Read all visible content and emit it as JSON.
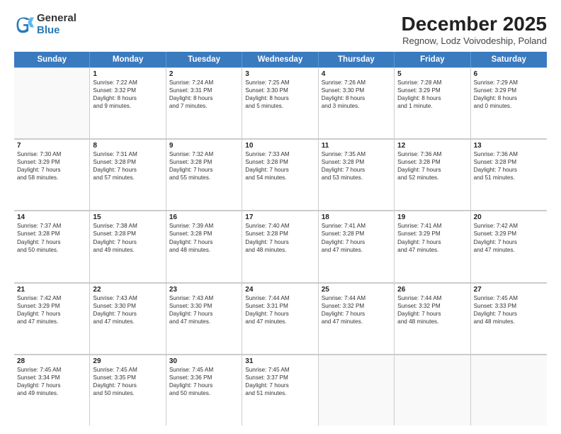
{
  "logo": {
    "general": "General",
    "blue": "Blue"
  },
  "header": {
    "title": "December 2025",
    "subtitle": "Regnow, Lodz Voivodeship, Poland"
  },
  "weekdays": [
    "Sunday",
    "Monday",
    "Tuesday",
    "Wednesday",
    "Thursday",
    "Friday",
    "Saturday"
  ],
  "weeks": [
    [
      {
        "day": "",
        "info": ""
      },
      {
        "day": "1",
        "info": "Sunrise: 7:22 AM\nSunset: 3:32 PM\nDaylight: 8 hours\nand 9 minutes."
      },
      {
        "day": "2",
        "info": "Sunrise: 7:24 AM\nSunset: 3:31 PM\nDaylight: 8 hours\nand 7 minutes."
      },
      {
        "day": "3",
        "info": "Sunrise: 7:25 AM\nSunset: 3:30 PM\nDaylight: 8 hours\nand 5 minutes."
      },
      {
        "day": "4",
        "info": "Sunrise: 7:26 AM\nSunset: 3:30 PM\nDaylight: 8 hours\nand 3 minutes."
      },
      {
        "day": "5",
        "info": "Sunrise: 7:28 AM\nSunset: 3:29 PM\nDaylight: 8 hours\nand 1 minute."
      },
      {
        "day": "6",
        "info": "Sunrise: 7:29 AM\nSunset: 3:29 PM\nDaylight: 8 hours\nand 0 minutes."
      }
    ],
    [
      {
        "day": "7",
        "info": "Sunrise: 7:30 AM\nSunset: 3:29 PM\nDaylight: 7 hours\nand 58 minutes."
      },
      {
        "day": "8",
        "info": "Sunrise: 7:31 AM\nSunset: 3:28 PM\nDaylight: 7 hours\nand 57 minutes."
      },
      {
        "day": "9",
        "info": "Sunrise: 7:32 AM\nSunset: 3:28 PM\nDaylight: 7 hours\nand 55 minutes."
      },
      {
        "day": "10",
        "info": "Sunrise: 7:33 AM\nSunset: 3:28 PM\nDaylight: 7 hours\nand 54 minutes."
      },
      {
        "day": "11",
        "info": "Sunrise: 7:35 AM\nSunset: 3:28 PM\nDaylight: 7 hours\nand 53 minutes."
      },
      {
        "day": "12",
        "info": "Sunrise: 7:36 AM\nSunset: 3:28 PM\nDaylight: 7 hours\nand 52 minutes."
      },
      {
        "day": "13",
        "info": "Sunrise: 7:36 AM\nSunset: 3:28 PM\nDaylight: 7 hours\nand 51 minutes."
      }
    ],
    [
      {
        "day": "14",
        "info": "Sunrise: 7:37 AM\nSunset: 3:28 PM\nDaylight: 7 hours\nand 50 minutes."
      },
      {
        "day": "15",
        "info": "Sunrise: 7:38 AM\nSunset: 3:28 PM\nDaylight: 7 hours\nand 49 minutes."
      },
      {
        "day": "16",
        "info": "Sunrise: 7:39 AM\nSunset: 3:28 PM\nDaylight: 7 hours\nand 48 minutes."
      },
      {
        "day": "17",
        "info": "Sunrise: 7:40 AM\nSunset: 3:28 PM\nDaylight: 7 hours\nand 48 minutes."
      },
      {
        "day": "18",
        "info": "Sunrise: 7:41 AM\nSunset: 3:28 PM\nDaylight: 7 hours\nand 47 minutes."
      },
      {
        "day": "19",
        "info": "Sunrise: 7:41 AM\nSunset: 3:29 PM\nDaylight: 7 hours\nand 47 minutes."
      },
      {
        "day": "20",
        "info": "Sunrise: 7:42 AM\nSunset: 3:29 PM\nDaylight: 7 hours\nand 47 minutes."
      }
    ],
    [
      {
        "day": "21",
        "info": "Sunrise: 7:42 AM\nSunset: 3:29 PM\nDaylight: 7 hours\nand 47 minutes."
      },
      {
        "day": "22",
        "info": "Sunrise: 7:43 AM\nSunset: 3:30 PM\nDaylight: 7 hours\nand 47 minutes."
      },
      {
        "day": "23",
        "info": "Sunrise: 7:43 AM\nSunset: 3:30 PM\nDaylight: 7 hours\nand 47 minutes."
      },
      {
        "day": "24",
        "info": "Sunrise: 7:44 AM\nSunset: 3:31 PM\nDaylight: 7 hours\nand 47 minutes."
      },
      {
        "day": "25",
        "info": "Sunrise: 7:44 AM\nSunset: 3:32 PM\nDaylight: 7 hours\nand 47 minutes."
      },
      {
        "day": "26",
        "info": "Sunrise: 7:44 AM\nSunset: 3:32 PM\nDaylight: 7 hours\nand 48 minutes."
      },
      {
        "day": "27",
        "info": "Sunrise: 7:45 AM\nSunset: 3:33 PM\nDaylight: 7 hours\nand 48 minutes."
      }
    ],
    [
      {
        "day": "28",
        "info": "Sunrise: 7:45 AM\nSunset: 3:34 PM\nDaylight: 7 hours\nand 49 minutes."
      },
      {
        "day": "29",
        "info": "Sunrise: 7:45 AM\nSunset: 3:35 PM\nDaylight: 7 hours\nand 50 minutes."
      },
      {
        "day": "30",
        "info": "Sunrise: 7:45 AM\nSunset: 3:36 PM\nDaylight: 7 hours\nand 50 minutes."
      },
      {
        "day": "31",
        "info": "Sunrise: 7:45 AM\nSunset: 3:37 PM\nDaylight: 7 hours\nand 51 minutes."
      },
      {
        "day": "",
        "info": ""
      },
      {
        "day": "",
        "info": ""
      },
      {
        "day": "",
        "info": ""
      }
    ]
  ]
}
